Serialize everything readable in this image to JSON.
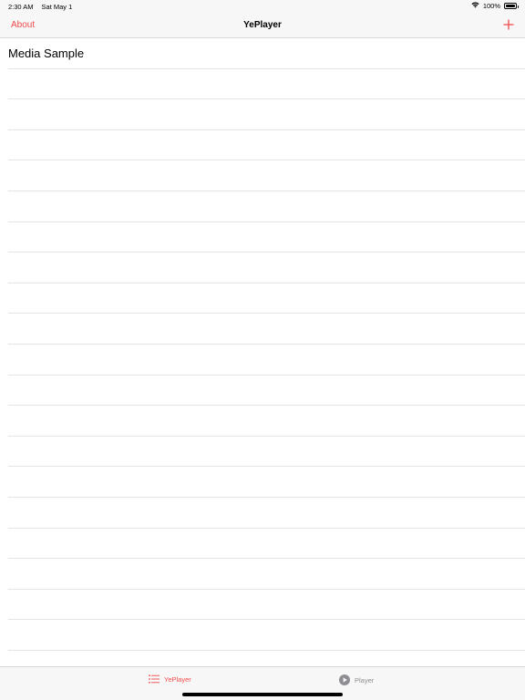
{
  "status_bar": {
    "time": "2:30 AM",
    "date": "Sat May 1",
    "battery_text": "100%",
    "battery_level": 100
  },
  "nav": {
    "left_label": "About",
    "title": "YePlayer",
    "add_icon": "plus-icon"
  },
  "list": {
    "items": [
      {
        "label": "Media Sample"
      },
      {
        "label": ""
      },
      {
        "label": ""
      },
      {
        "label": ""
      },
      {
        "label": ""
      },
      {
        "label": ""
      },
      {
        "label": ""
      },
      {
        "label": ""
      },
      {
        "label": ""
      },
      {
        "label": ""
      },
      {
        "label": ""
      },
      {
        "label": ""
      },
      {
        "label": ""
      },
      {
        "label": ""
      },
      {
        "label": ""
      },
      {
        "label": ""
      },
      {
        "label": ""
      },
      {
        "label": ""
      },
      {
        "label": ""
      },
      {
        "label": ""
      },
      {
        "label": ""
      }
    ]
  },
  "tab_bar": {
    "tabs": [
      {
        "label": "YePlayer",
        "icon": "list-icon",
        "selected": true
      },
      {
        "label": "Player",
        "icon": "play-circle-icon",
        "selected": false
      }
    ]
  },
  "colors": {
    "accent": "#f04a4a",
    "inactive": "#8e8e93",
    "bar_background": "#f7f7f7",
    "separator": "#e4e4e4"
  }
}
